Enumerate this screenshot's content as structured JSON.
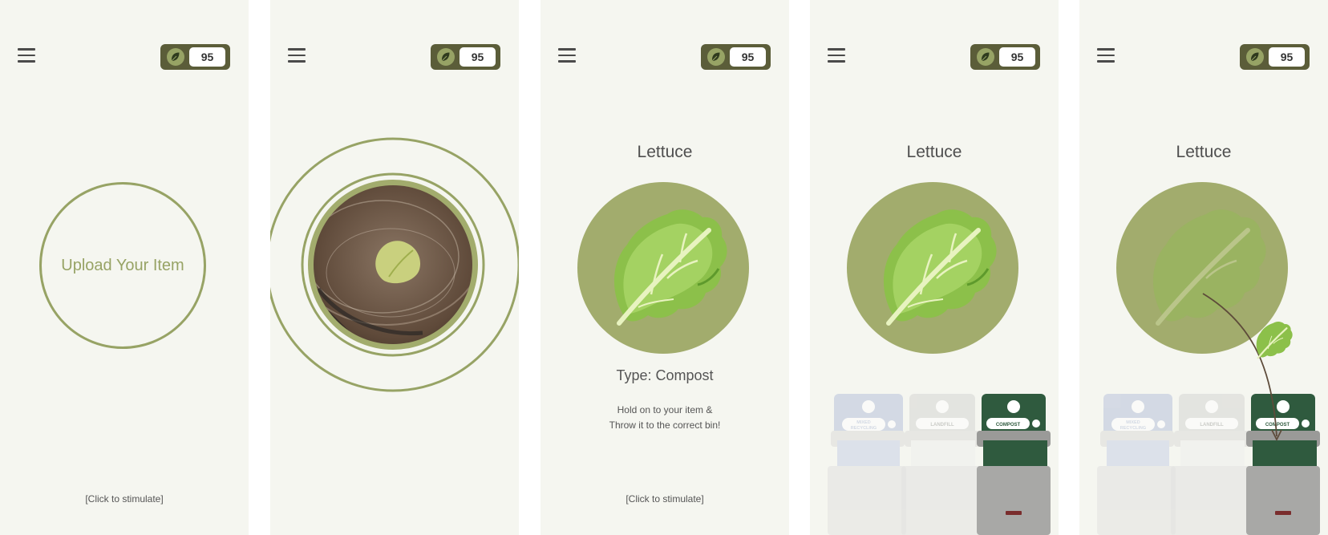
{
  "score": "95",
  "screens": [
    {
      "id": "upload",
      "upload_label": "Upload Your Item",
      "click_hint": "[Click to stimulate]"
    },
    {
      "id": "scanning"
    },
    {
      "id": "result",
      "item_name": "Lettuce",
      "type_label": "Type: Compost",
      "instruction_line1": "Hold on to your item &",
      "instruction_line2": "Throw it to the correct bin!",
      "click_hint": "[Click to stimulate]"
    },
    {
      "id": "bins",
      "item_name": "Lettuce"
    },
    {
      "id": "drop",
      "item_name": "Lettuce"
    }
  ],
  "bins": [
    {
      "label_line1": "MIXED",
      "label_line2": "RECYCLING",
      "icon": "bottle-icon",
      "state": "dimmed"
    },
    {
      "label_line1": "LANDFILL",
      "icon": "trash-can-icon",
      "state": "dimmed"
    },
    {
      "label_line1": "COMPOST",
      "icon": "compost-icon",
      "state": "active"
    }
  ],
  "colors": {
    "background": "#f5f6f0",
    "accent_olive": "#97a365",
    "circle_fill": "#a2ac6d",
    "badge": "#5b5d39",
    "lettuce": "#8cc04a",
    "compost_bin": "#2f5a3e",
    "recycling_bin": "#b9c3dc",
    "landfill_bin": "#d6d6d4"
  },
  "icons": {
    "menu": "hamburger-menu-icon",
    "score": "leaf-icon"
  }
}
